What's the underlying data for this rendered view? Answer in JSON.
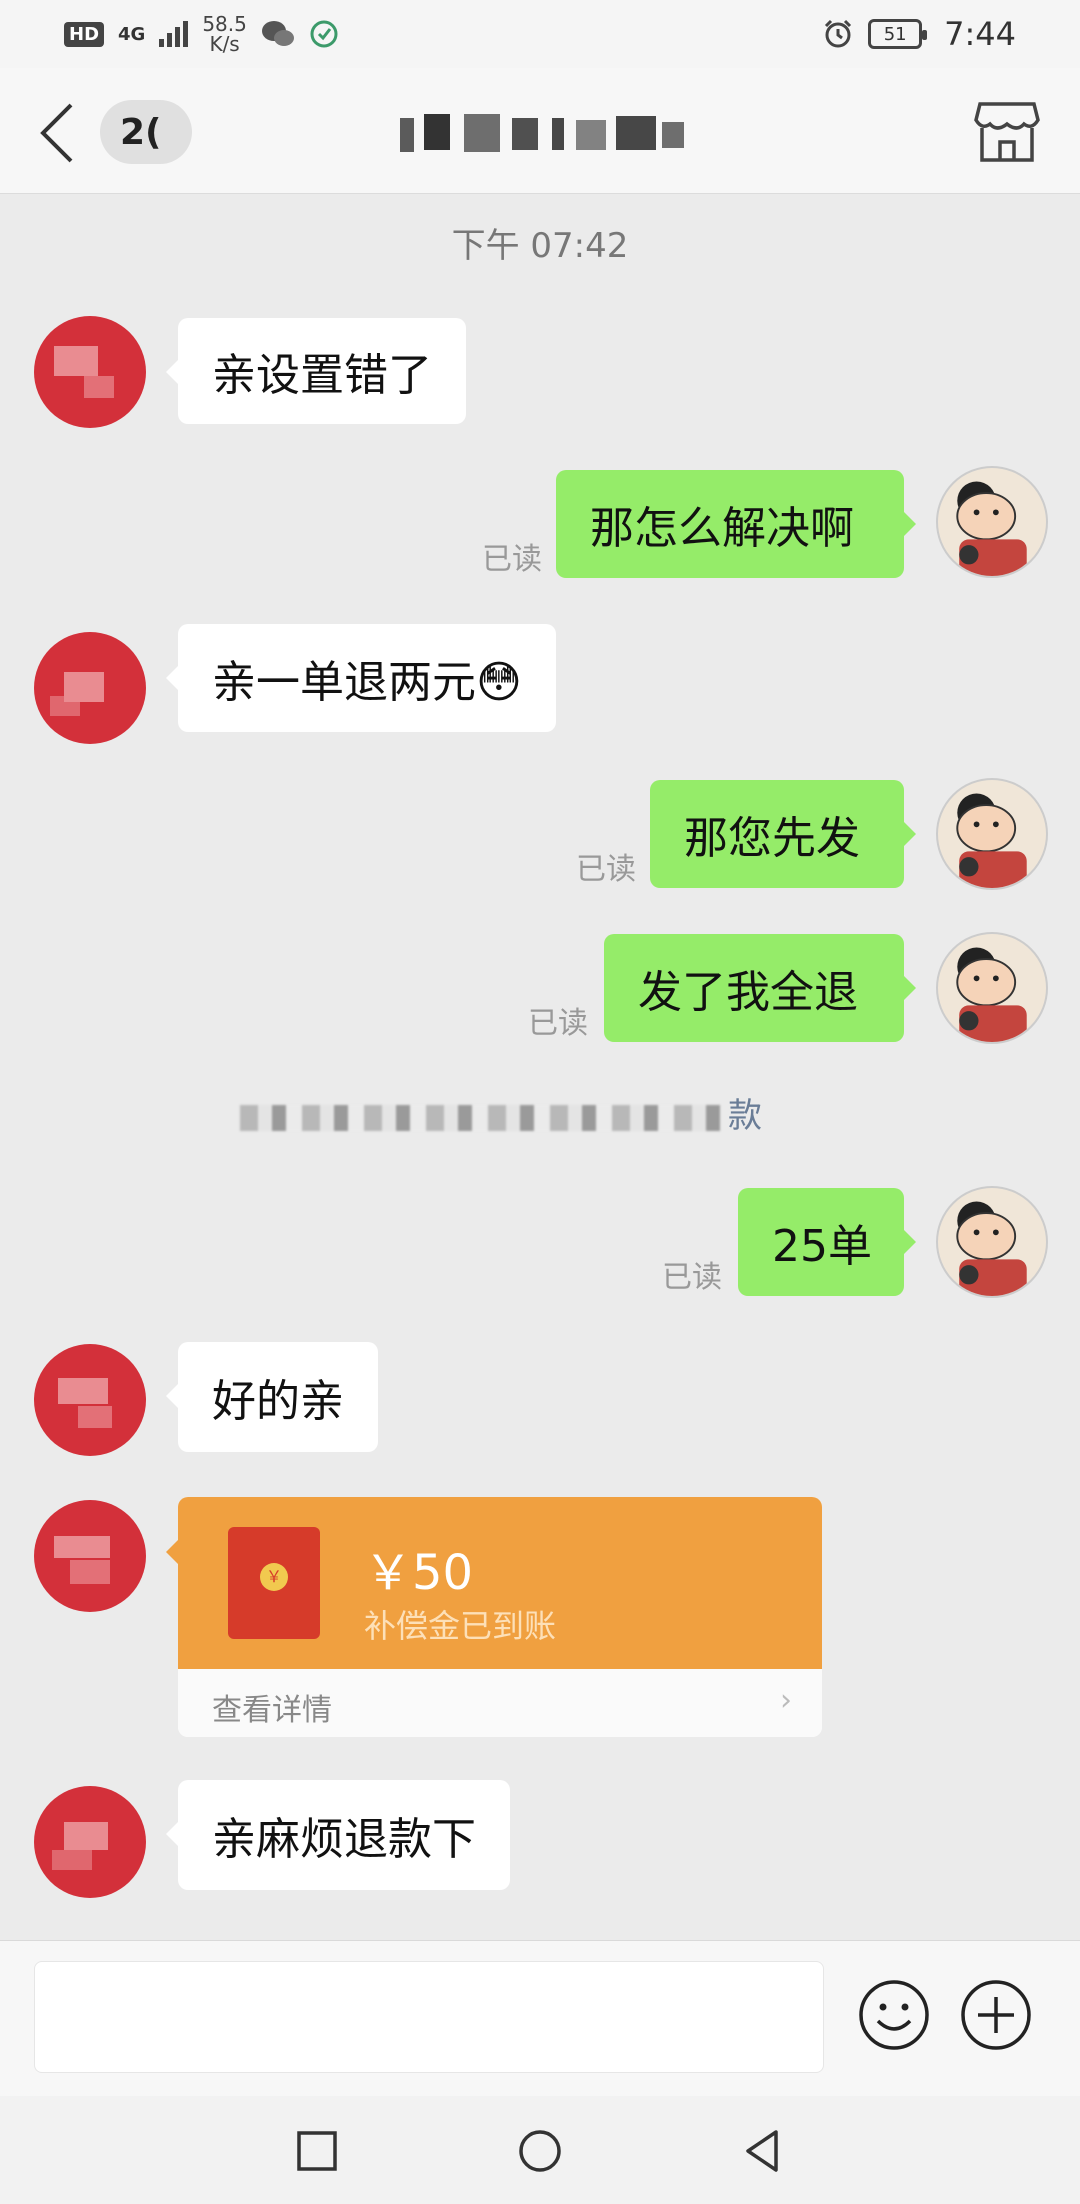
{
  "status_bar": {
    "hd": "HD",
    "network": "4G",
    "speed_value": "58.5",
    "speed_unit": "K/s",
    "battery": "51",
    "time": "7:44"
  },
  "header": {
    "back_icon": "chevron-left-icon",
    "unread_count": "2(",
    "title": "",
    "store_icon": "store-icon"
  },
  "chat": {
    "timestamp": "下午 07:42",
    "read_label": "已读",
    "messages": [
      {
        "from": "them",
        "text": "亲设置错了"
      },
      {
        "from": "me",
        "text": "那怎么解决啊",
        "read": "已读"
      },
      {
        "from": "them",
        "text": "亲一单退两元😳"
      },
      {
        "from": "me",
        "text": "那您先发",
        "read": "已读"
      },
      {
        "from": "me",
        "text": "发了我全退",
        "read": "已读"
      },
      {
        "from": "me",
        "text": "25单",
        "read": "已读"
      },
      {
        "from": "them",
        "text": "好的亲"
      },
      {
        "from": "them",
        "text": "亲麻烦退款下"
      }
    ],
    "system_note_tail": "款",
    "red_packet": {
      "amount": "￥50",
      "subtitle": "补偿金已到账",
      "link": "查看详情",
      "color": "#f0a040"
    }
  },
  "input_bar": {
    "placeholder": "",
    "emoji_icon": "smiley-face-icon",
    "plus_icon": "plus-circle-icon"
  },
  "nav_bar": {
    "recent_icon": "square-icon",
    "home_icon": "circle-icon",
    "back_icon": "triangle-back-icon"
  },
  "colors": {
    "my_bubble": "#95ec69",
    "their_bubble": "#ffffff",
    "background": "#ebebeb"
  }
}
